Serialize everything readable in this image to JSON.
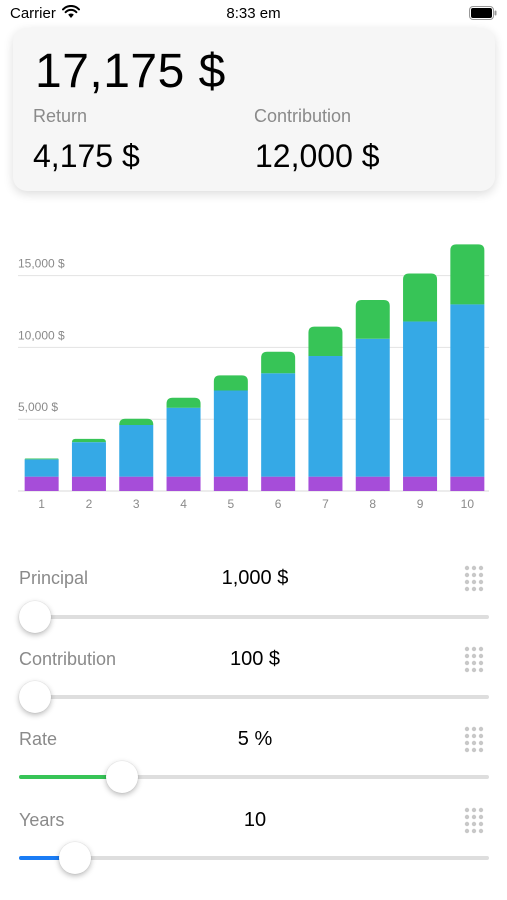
{
  "status_bar": {
    "carrier": "Carrier",
    "time": "8:33 em"
  },
  "summary": {
    "total": "17,175 $",
    "return_label": "Return",
    "return_value": "4,175 $",
    "contribution_label": "Contribution",
    "contribution_value": "12,000 $"
  },
  "chart_data": {
    "type": "bar",
    "stacked": true,
    "categories": [
      "1",
      "2",
      "3",
      "4",
      "5",
      "6",
      "7",
      "8",
      "9",
      "10"
    ],
    "series": [
      {
        "values": [
          1000,
          1000,
          1000,
          1000,
          1000,
          1000,
          1000,
          1000,
          1000,
          1000
        ],
        "color": "#a64dd9"
      },
      {
        "values": [
          1200,
          2400,
          3600,
          4800,
          6000,
          7200,
          8400,
          9600,
          10800,
          12000
        ],
        "color": "#35a9e6"
      },
      {
        "values": [
          60,
          230,
          430,
          690,
          1050,
          1500,
          2050,
          2700,
          3350,
          4175
        ],
        "color": "#37c457"
      }
    ],
    "y_ticks": [
      {
        "value": 5000,
        "label": "5,000 $"
      },
      {
        "value": 10000,
        "label": "10,000 $"
      },
      {
        "value": 15000,
        "label": "15,000 $"
      }
    ],
    "ylim": [
      0,
      17500
    ],
    "grid": true
  },
  "controls": [
    {
      "label": "Principal",
      "value": "1,000 $",
      "fraction": 0.035,
      "fill_color": ""
    },
    {
      "label": "Contribution",
      "value": "100 $",
      "fraction": 0.035,
      "fill_color": ""
    },
    {
      "label": "Rate",
      "value": "5 %",
      "fraction": 0.22,
      "fill_color": "#37c457"
    },
    {
      "label": "Years",
      "value": "10",
      "fraction": 0.12,
      "fill_color": "#1a7cf5"
    }
  ]
}
